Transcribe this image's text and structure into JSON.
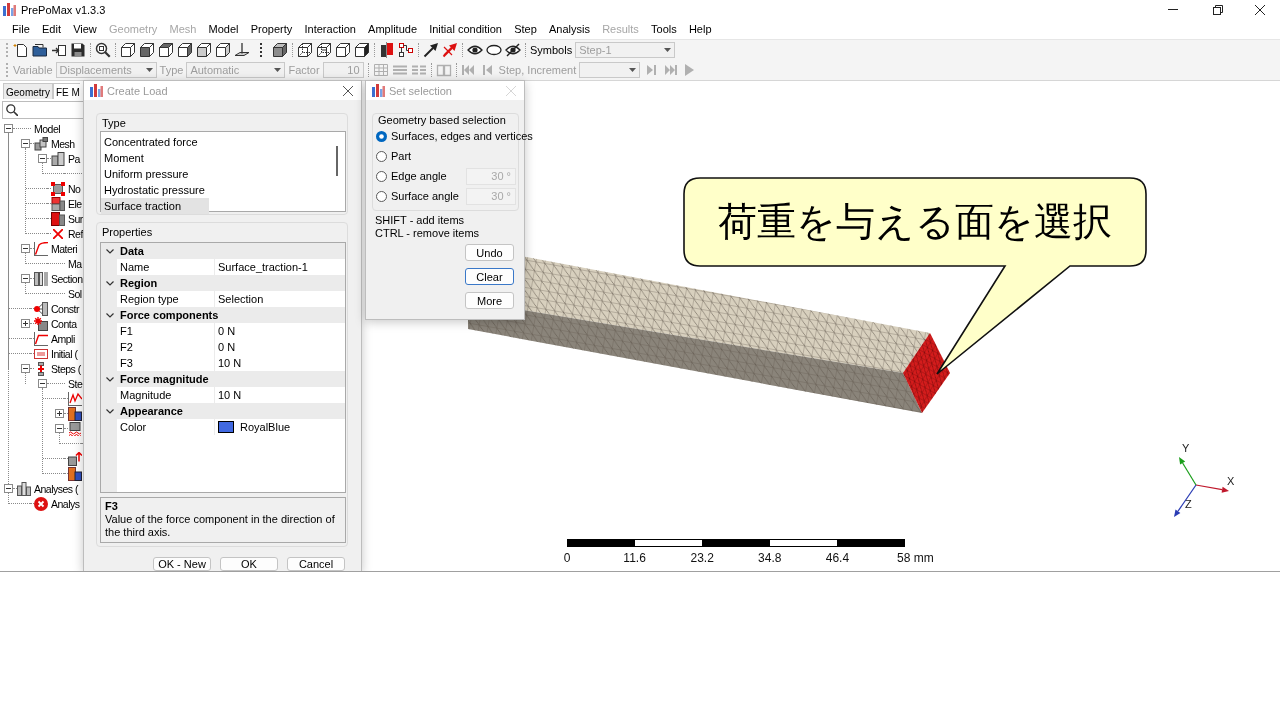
{
  "window": {
    "title": "PrePoMax v1.3.3"
  },
  "menu": [
    {
      "label": "File",
      "disabled": false
    },
    {
      "label": "Edit",
      "disabled": false
    },
    {
      "label": "View",
      "disabled": false
    },
    {
      "label": "Geometry",
      "disabled": true
    },
    {
      "label": "Mesh",
      "disabled": true
    },
    {
      "label": "Model",
      "disabled": false
    },
    {
      "label": "Property",
      "disabled": false
    },
    {
      "label": "Interaction",
      "disabled": false
    },
    {
      "label": "Amplitude",
      "disabled": false
    },
    {
      "label": "Initial condition",
      "disabled": false
    },
    {
      "label": "Step",
      "disabled": false
    },
    {
      "label": "Analysis",
      "disabled": false
    },
    {
      "label": "Results",
      "disabled": true
    },
    {
      "label": "Tools",
      "disabled": false
    },
    {
      "label": "Help",
      "disabled": false
    }
  ],
  "main_toolbar": {
    "symbols_label": "Symbols",
    "symbols_value": "Step-1",
    "symbols_disabled": true
  },
  "results_toolbar": {
    "disabled": true,
    "variable_label": "Variable",
    "variable_value": "Displacements",
    "type_label": "Type",
    "type_value": "Automatic",
    "factor_label": "Factor",
    "factor_value": "10",
    "step_label": "Step, Increment"
  },
  "side_panel": {
    "tabs": [
      {
        "label": "Geometry",
        "selected": false
      },
      {
        "label": "FE M",
        "selected": true
      }
    ],
    "tree": [
      {
        "label": "Model",
        "kind": "plain",
        "expanded": true,
        "children": [
          {
            "label": "Mesh",
            "kind": "mesh",
            "expanded": true,
            "children": [
              {
                "label": "Pa",
                "kind": "part",
                "expanded": true,
                "children": [
                  {
                    "kind": "plain"
                  }
                ]
              },
              {
                "label": "No",
                "kind": "node-set"
              },
              {
                "label": "Ele",
                "kind": "element-set"
              },
              {
                "label": "Sur",
                "kind": "surface"
              },
              {
                "label": "Ref",
                "kind": "reference-point"
              }
            ]
          },
          {
            "label": "Materi",
            "kind": "material",
            "expanded": true,
            "children": [
              {
                "label": "Ma",
                "kind": "plain"
              }
            ]
          },
          {
            "label": "Section",
            "kind": "section",
            "expanded": true,
            "children": [
              {
                "label": "Sol",
                "kind": "plain"
              }
            ]
          },
          {
            "label": "Constr",
            "kind": "constraint"
          },
          {
            "label": "Conta",
            "kind": "contact",
            "expanded": false
          },
          {
            "label": "Ampli",
            "kind": "amplitude"
          },
          {
            "label": "Initial (",
            "kind": "initial-condition"
          },
          {
            "label": "Steps (",
            "kind": "steps",
            "expanded": true,
            "children": [
              {
                "label": "Ste",
                "kind": "plain",
                "expanded": true,
                "children": [
                  {
                    "kind": "wave"
                  },
                  {
                    "kind": "block-pair",
                    "expanded": false
                  },
                  {
                    "kind": "block-springs",
                    "expanded": true
                  },
                  {
                    "kind": "block-arrow"
                  },
                  {
                    "kind": "block-pair"
                  }
                ]
              }
            ]
          }
        ]
      },
      {
        "label": "Analyses (",
        "kind": "analyses",
        "expanded": true,
        "children": [
          {
            "label": "Analys",
            "kind": "error"
          }
        ]
      }
    ]
  },
  "create_load_dialog": {
    "title": "Create Load",
    "active": false,
    "close_disabled": false,
    "type_group": "Type",
    "types": [
      {
        "label": "Concentrated force",
        "selected": false
      },
      {
        "label": "Moment",
        "selected": false
      },
      {
        "label": "Uniform pressure",
        "selected": false
      },
      {
        "label": "Hydrostatic pressure",
        "selected": false
      },
      {
        "label": "Surface traction",
        "selected": true
      }
    ],
    "properties_group": "Properties",
    "properties": [
      {
        "category": "Data",
        "expanded": true,
        "rows": [
          {
            "name": "Name",
            "value": "Surface_traction-1"
          }
        ]
      },
      {
        "category": "Region",
        "expanded": true,
        "rows": [
          {
            "name": "Region type",
            "value": "Selection"
          }
        ]
      },
      {
        "category": "Force components",
        "expanded": true,
        "rows": [
          {
            "name": "F1",
            "value": "0 N"
          },
          {
            "name": "F2",
            "value": "0 N"
          },
          {
            "name": "F3",
            "value": "10 N"
          }
        ]
      },
      {
        "category": "Force magnitude",
        "expanded": true,
        "rows": [
          {
            "name": "Magnitude",
            "value": "10 N"
          }
        ]
      },
      {
        "category": "Appearance",
        "expanded": true,
        "rows": [
          {
            "name": "Color",
            "value": "RoyalBlue",
            "color": "#4169e1"
          }
        ]
      }
    ],
    "description": {
      "title": "F3",
      "text": "Value of the force component in the direction of the third axis."
    },
    "buttons": [
      "OK - New",
      "OK",
      "Cancel"
    ]
  },
  "set_selection_dialog": {
    "title": "Set selection",
    "active": false,
    "close_disabled": true,
    "group": "Geometry based selection",
    "options": [
      {
        "label": "Surfaces, edges and vertices",
        "selected": true
      },
      {
        "label": "Part",
        "selected": false
      },
      {
        "label": "Edge angle",
        "selected": false,
        "angle": "30 °",
        "angle_disabled": true
      },
      {
        "label": "Surface angle",
        "selected": false,
        "angle": "30 °",
        "angle_disabled": true
      }
    ],
    "hints": [
      "SHIFT - add items",
      "CTRL - remove items"
    ],
    "buttons": [
      {
        "label": "Undo",
        "focused": false
      },
      {
        "label": "Clear",
        "focused": true
      },
      {
        "label": "More",
        "focused": false
      }
    ]
  },
  "viewport": {
    "callout": "荷重を与える面を選択",
    "axes": [
      {
        "label": "X",
        "color": "#c0182c"
      },
      {
        "label": "Y",
        "color": "#1a9e1a"
      },
      {
        "label": "Z",
        "color": "#2a3cb4"
      }
    ],
    "scale_bar": [
      "0",
      "11.6",
      "23.2",
      "34.8",
      "46.4",
      "58 mm"
    ]
  }
}
